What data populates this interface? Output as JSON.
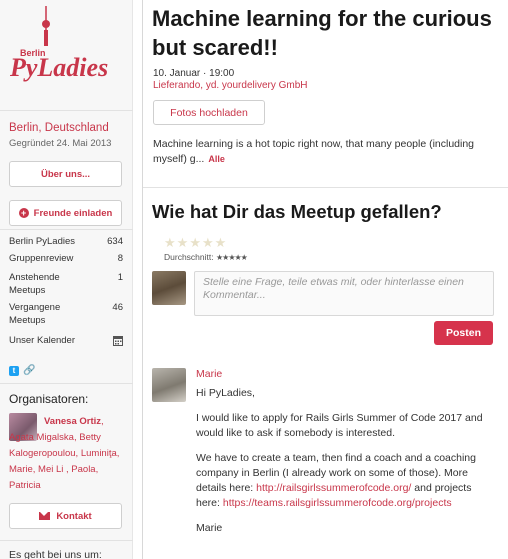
{
  "sidebar": {
    "logo": {
      "city": "Berlin",
      "name": "PyLadies"
    },
    "location": "Berlin, Deutschland",
    "founded": "Gegründet 24. Mai 2013",
    "about_button": "Über uns...",
    "invite_button": "Freunde einladen",
    "stats": [
      {
        "label": "Berlin PyLadies",
        "value": "634"
      },
      {
        "label": "Gruppenreview",
        "value": "8"
      },
      {
        "label": "Anstehende Meetups",
        "value": "1"
      },
      {
        "label": "Vergangene Meetups",
        "value": "46"
      },
      {
        "label": "Unser Kalender",
        "value": ""
      }
    ],
    "organizers_title": "Organisatoren:",
    "organizer_primary": "Vanesa Ortiz",
    "organizers_rest": ", Agata Migalska, Betty Kalogeropoulou, Luminiţa, Marie, Mei Li , Paola, Patricia",
    "contact_button": "Kontakt",
    "bottom_text": "Es geht bei uns um:"
  },
  "event": {
    "title": "Machine learning for the curious but scared!!",
    "date": "10. Januar · 19:00",
    "location": "Lieferando, yd. yourdelivery GmbH",
    "upload_button": "Fotos hochladen",
    "description": "Machine learning is a hot topic right now, that many people (including myself) g...",
    "more_link": "Alle"
  },
  "rating": {
    "title": "Wie hat Dir das Meetup gefallen?",
    "average_label": "Durchschnitt:",
    "stars_rating": 0
  },
  "comment_form": {
    "placeholder": "Stelle eine Frage, teile etwas mit, oder hinterlasse einen Kommentar...",
    "submit_label": "Posten"
  },
  "comment": {
    "author": "Marie",
    "greeting": "Hi PyLadies,",
    "p1": "I would like to apply for Rails Girls Summer of Code 2017 and would like to ask if somebody is interested.",
    "p2_start": "We have to create a team, then find a coach and a coaching company in Berlin (I already work on some of those). More details here: ",
    "link1": "http://railsgirlssummerofcode.org/",
    "p2_mid": " and projects here: ",
    "link2": "https://teams.railsgirlssummerofcode.org/projects",
    "signoff": "Marie"
  },
  "colors": {
    "accent": "#c8364a",
    "button_primary": "#d6334c"
  }
}
